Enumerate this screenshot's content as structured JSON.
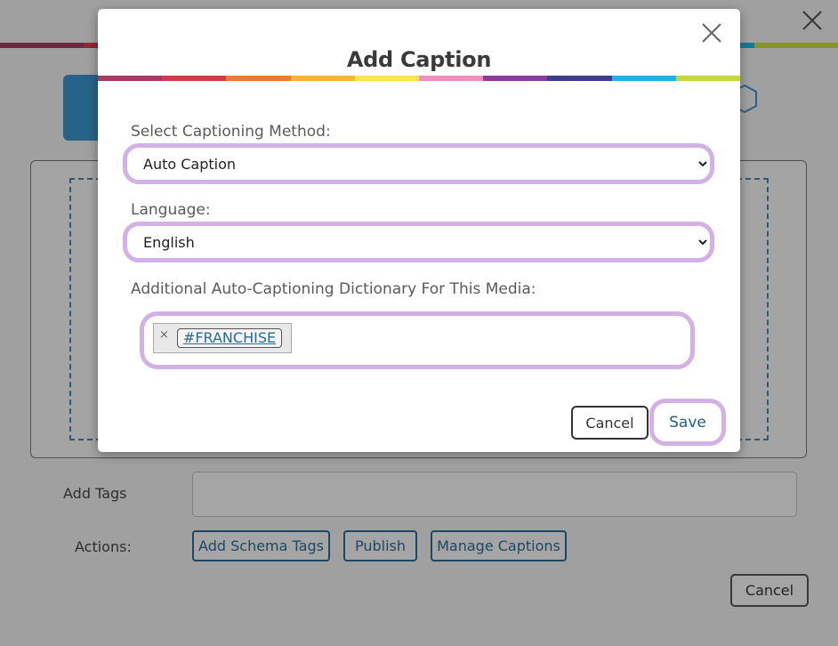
{
  "colors": {
    "rainbow": [
      "#a63c62",
      "#d63a4a",
      "#f07b2f",
      "#f7b632",
      "#f6e84b",
      "#ef8fbf",
      "#8c3b9b",
      "#3c3d8d",
      "#1cb4e3",
      "#c6d93b"
    ],
    "selection_ring": "#d3b0e6",
    "link_blue": "#2a6a94"
  },
  "modal": {
    "title": "Add Caption",
    "close_icon": "close-icon",
    "caption_method": {
      "label": "Select Captioning Method:",
      "selected": "Auto Caption"
    },
    "language": {
      "label": "Language:",
      "selected": "English"
    },
    "dictionary": {
      "label": "Additional Auto-Captioning Dictionary For This Media:",
      "tags": [
        "#FRANCHISE"
      ],
      "remove_glyph": "×"
    },
    "cancel_label": "Cancel",
    "save_label": "Save"
  },
  "background": {
    "add_tags_label": "Add Tags",
    "actions_label": "Actions:",
    "actions": [
      "Add Schema Tags",
      "Publish",
      "Manage Captions"
    ],
    "cancel_label": "Cancel"
  }
}
